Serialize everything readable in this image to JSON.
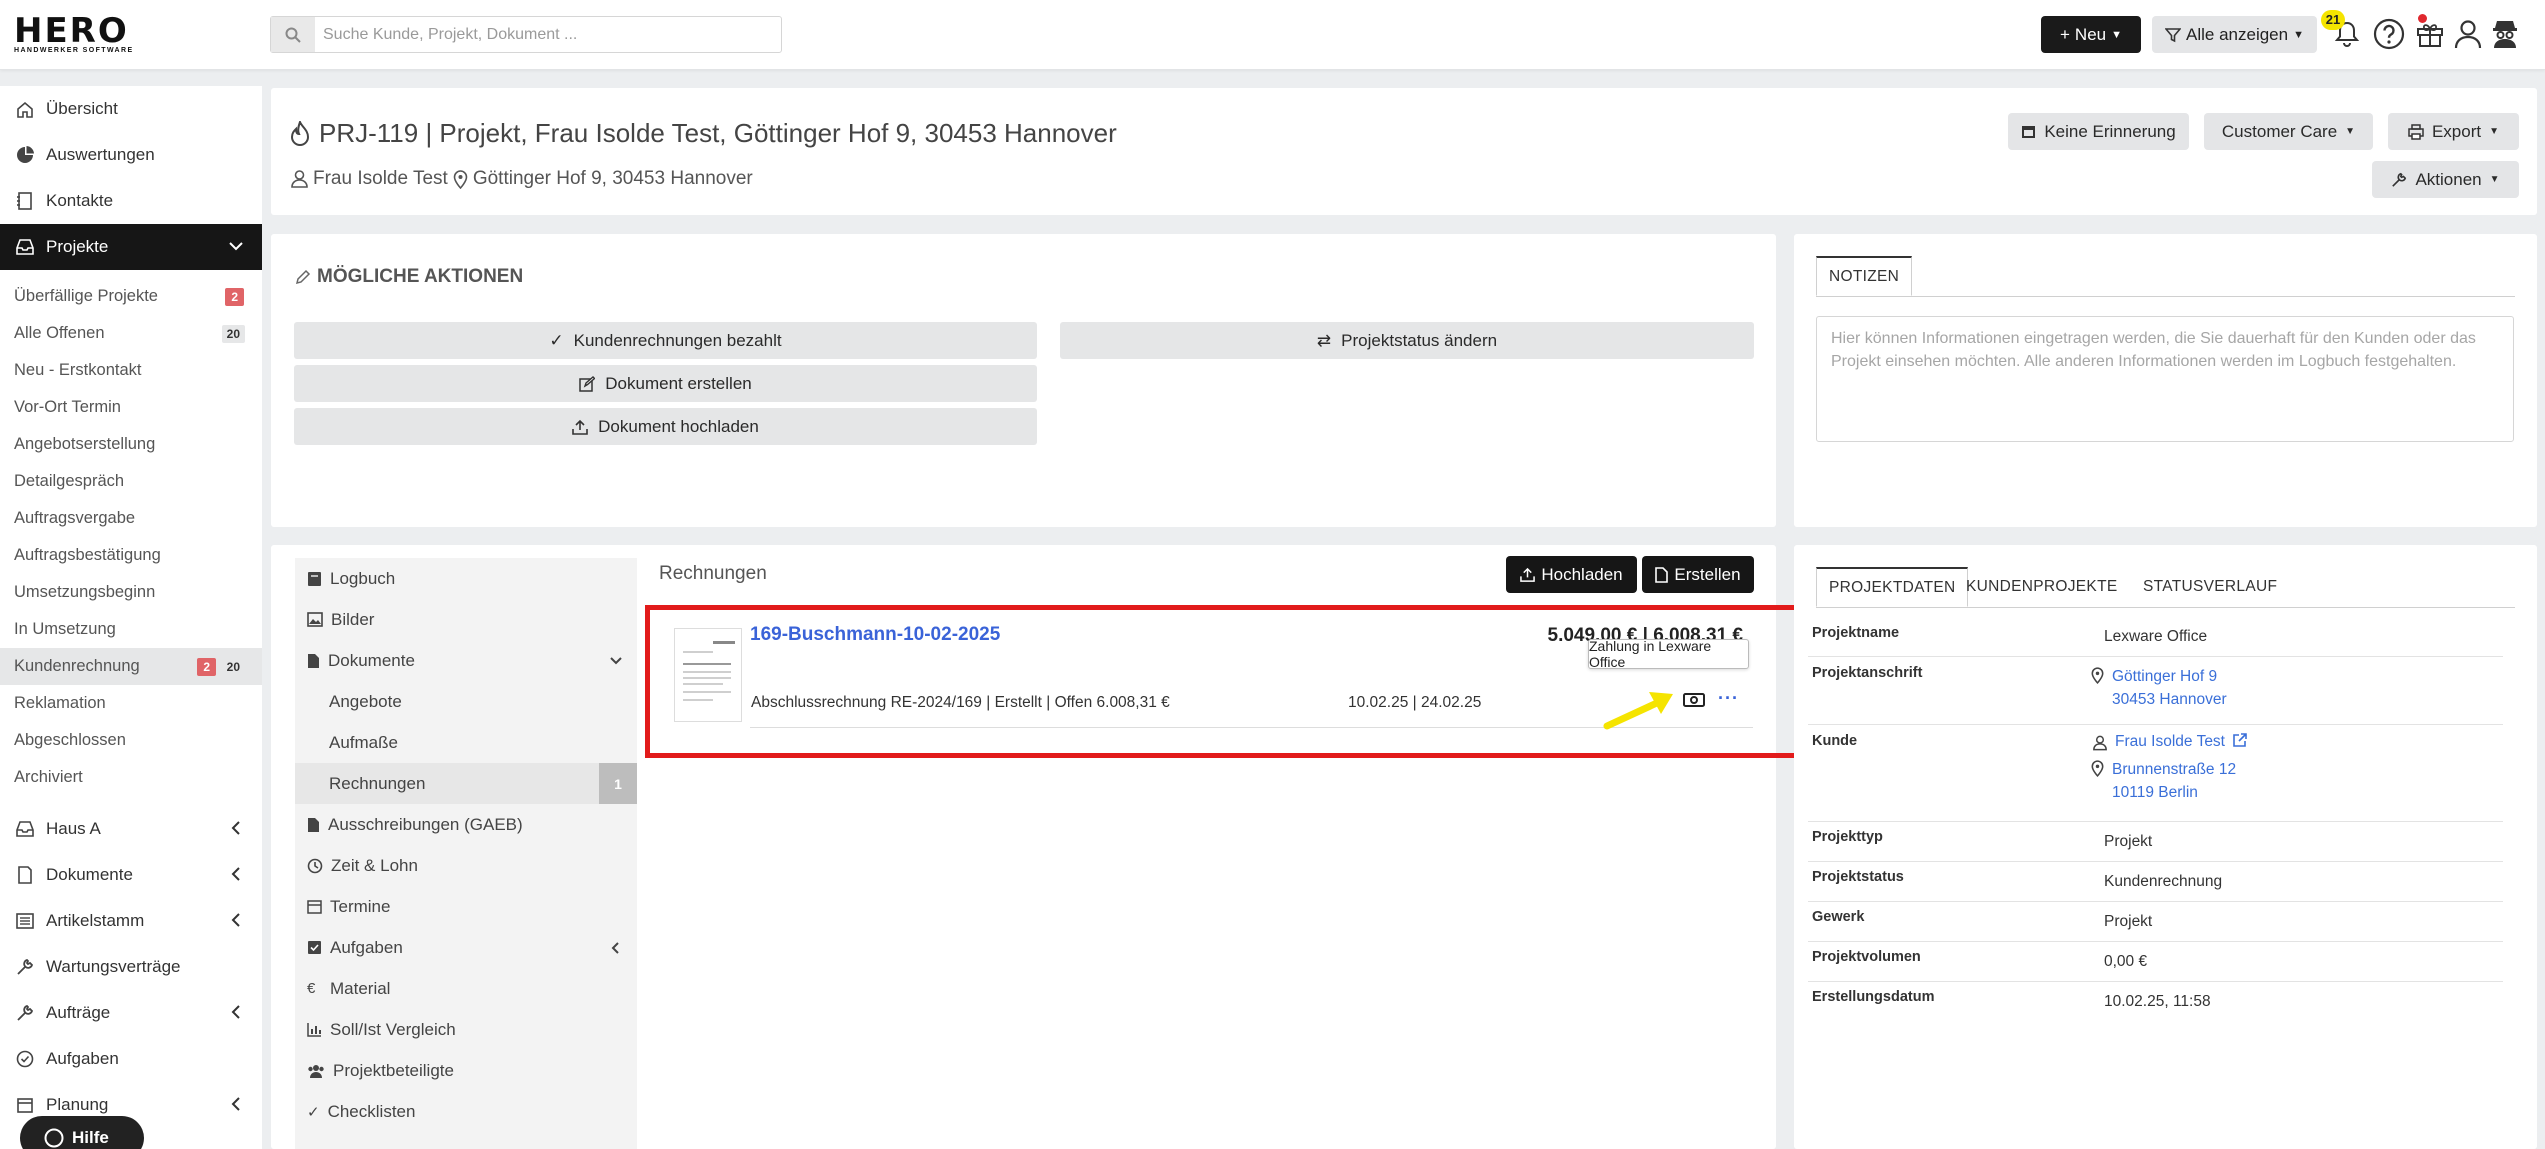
{
  "topbar": {
    "logo_main": "HERO",
    "logo_sub": "HANDWERKER SOFTWARE",
    "search_placeholder": "Suche Kunde, Projekt, Dokument ...",
    "new_label": "Neu",
    "filter_label": "Alle anzeigen",
    "notification_count": "21"
  },
  "sidebar": {
    "main_top": [
      {
        "label": "Übersicht",
        "icon": "home-icon"
      },
      {
        "label": "Auswertungen",
        "icon": "pie-chart-icon"
      },
      {
        "label": "Kontakte",
        "icon": "address-book-icon"
      },
      {
        "label": "Projekte",
        "icon": "inbox-icon"
      }
    ],
    "project_filters": [
      {
        "label": "Überfällige Projekte",
        "badge_red": "2"
      },
      {
        "label": "Alle Offenen",
        "badge_gray": "20"
      },
      {
        "label": "Neu - Erstkontakt"
      },
      {
        "label": "Vor-Ort Termin"
      },
      {
        "label": "Angebotserstellung"
      },
      {
        "label": "Detailgespräch"
      },
      {
        "label": "Auftragsvergabe"
      },
      {
        "label": "Auftragsbestätigung"
      },
      {
        "label": "Umsetzungsbeginn"
      },
      {
        "label": "In Umsetzung"
      },
      {
        "label": "Kundenrechnung",
        "badge_red": "2",
        "badge_gray": "20"
      },
      {
        "label": "Reklamation"
      },
      {
        "label": "Abgeschlossen"
      },
      {
        "label": "Archiviert"
      }
    ],
    "main_bottom": [
      {
        "label": "Haus A",
        "icon": "inbox-icon"
      },
      {
        "label": "Dokumente",
        "icon": "document-icon"
      },
      {
        "label": "Artikelstamm",
        "icon": "list-icon"
      },
      {
        "label": "Wartungsverträge",
        "icon": "wrench-icon"
      },
      {
        "label": "Aufträge",
        "icon": "wrench-icon"
      },
      {
        "label": "Aufgaben",
        "icon": "check-circle-icon"
      },
      {
        "label": "Planung",
        "icon": "calendar-icon"
      }
    ],
    "help_label": "Hilfe"
  },
  "project": {
    "title": "PRJ-119 | Projekt, Frau Isolde Test, Göttinger Hof 9, 30453 Hannover",
    "customer": "Frau Isolde Test",
    "address": "Göttinger Hof 9, 30453 Hannover",
    "btn_reminder": "Keine Erinnerung",
    "btn_care": "Customer Care",
    "btn_export": "Export",
    "btn_actions": "Aktionen"
  },
  "actions": {
    "title": "MÖGLICHE AKTIONEN",
    "paid": "Kundenrechnungen bezahlt",
    "status": "Projektstatus ändern",
    "create_doc": "Dokument erstellen",
    "upload_doc": "Dokument hochladen"
  },
  "notes": {
    "tab": "NOTIZEN",
    "placeholder": "Hier können Informationen eingetragen werden, die Sie dauerhaft für den Kunden oder das Projekt einsehen möchten. Alle anderen Informationen werden im Logbuch festgehalten."
  },
  "docnav": [
    {
      "label": "Logbuch",
      "icon": "book-icon"
    },
    {
      "label": "Bilder",
      "icon": "image-icon"
    },
    {
      "label": "Dokumente",
      "icon": "file-icon"
    },
    {
      "label": "Angebote"
    },
    {
      "label": "Aufmaße"
    },
    {
      "label": "Rechnungen",
      "count": "1"
    },
    {
      "label": "Ausschreibungen (GAEB)",
      "icon": "file-icon"
    },
    {
      "label": "Zeit & Lohn",
      "icon": "clock-icon"
    },
    {
      "label": "Termine",
      "icon": "calendar-icon"
    },
    {
      "label": "Aufgaben",
      "icon": "checkbox-icon"
    },
    {
      "label": "Material",
      "icon": "euro-icon"
    },
    {
      "label": "Soll/Ist Vergleich",
      "icon": "bar-chart-icon"
    },
    {
      "label": "Projektbeteiligte",
      "icon": "users-icon"
    },
    {
      "label": "Checklisten",
      "icon": "check-icon"
    }
  ],
  "invoices": {
    "heading": "Rechnungen",
    "btn_upload": "Hochladen",
    "btn_create": "Erstellen",
    "item": {
      "title": "169-Buschmann-10-02-2025",
      "amounts": "5.049,00 € | 6.008,31 €",
      "description": "Abschlussrechnung RE-2024/169 | Erstellt | Offen 6.008,31 €",
      "dates": "10.02.25 | 24.02.25",
      "tooltip": "Zahlung in Lexware Office"
    }
  },
  "projectdata": {
    "tabs": [
      "PROJEKTDATEN",
      "KUNDENPROJEKTE",
      "STATUSVERLAUF"
    ],
    "rows": {
      "name_label": "Projektname",
      "name_value": "Lexware Office",
      "address_label": "Projektanschrift",
      "address_line1": "Göttinger Hof 9",
      "address_line2": "30453 Hannover",
      "customer_label": "Kunde",
      "customer_name": "Frau Isolde Test",
      "customer_street": "Brunnenstraße 12",
      "customer_city": "10119 Berlin",
      "type_label": "Projekttyp",
      "type_value": "Projekt",
      "status_label": "Projektstatus",
      "status_value": "Kundenrechnung",
      "trade_label": "Gewerk",
      "trade_value": "Projekt",
      "volume_label": "Projektvolumen",
      "volume_value": "0,00 €",
      "date_label": "Erstellungsdatum",
      "date_value": "10.02.25, 11:58"
    }
  },
  "colors": {
    "accent_link": "#3a63d8",
    "highlight_red": "#e21b1b",
    "arrow_yellow": "#f5e400",
    "badge_red": "#e06467"
  }
}
